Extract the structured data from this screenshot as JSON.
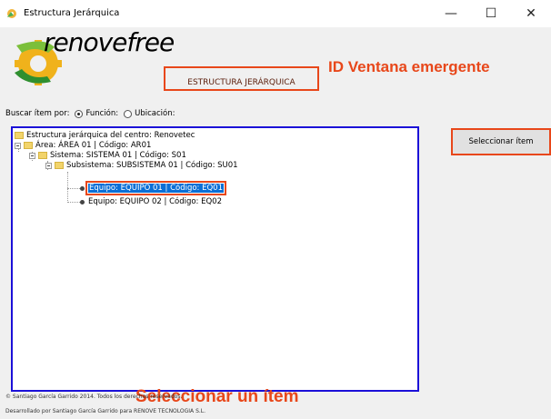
{
  "window": {
    "title": "Estructura Jerárquica",
    "controls": {
      "minimize": "—",
      "maximize": "☐",
      "close": "✕"
    }
  },
  "logo": {
    "text": "renovefree"
  },
  "heading": "ESTRUCTURA JERÁRQUICA",
  "annotations": {
    "window_id": "ID Ventana emergente",
    "select_item": "Seleccionar un ítem"
  },
  "search": {
    "label": "Buscar ítem por:",
    "options": [
      {
        "label": "Función:",
        "checked": true
      },
      {
        "label": "Ubicación:",
        "checked": false
      }
    ]
  },
  "tree": {
    "root": "Estructura jerárquica del centro: Renovetec",
    "area": "Área: ÁREA 01 | Código: AR01",
    "system": "Sistema: SISTEMA 01 | Código: S01",
    "subsystem": "Subsistema: SUBSISTEMA 01 | Código: SU01",
    "equipment": [
      {
        "label": "Equipo: EQUIPO 01 | Código: EQ01",
        "selected": true
      },
      {
        "label": "Equipo: EQUIPO 02 | Código: EQ02",
        "selected": false
      }
    ]
  },
  "buttons": {
    "select_item": "Seleccionar ítem"
  },
  "footer": {
    "copyright": "© Santiago García Garrido 2014. Todos los derechos reservados.",
    "developed_by": "Desarrollado por Santiago García Garrido para RENOVE TECNOLOGIA S.L."
  },
  "colors": {
    "annotation": "#e8471a",
    "tree_border": "#1b10d8",
    "selection": "#0b6fd6"
  },
  "icons": {
    "app": "gear-app-icon",
    "folder": "folder-icon",
    "leaf": "dot-icon"
  }
}
